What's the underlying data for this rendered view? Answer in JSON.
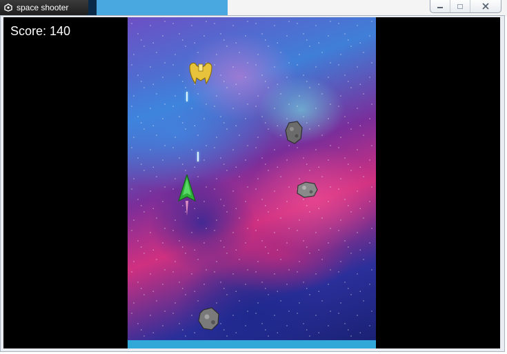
{
  "window": {
    "title": "space shooter",
    "icon": "unity-icon",
    "controls": [
      "minimize-icon",
      "maximize-icon",
      "close-icon"
    ]
  },
  "hud": {
    "score_label": "Score:",
    "score_value": "140",
    "score_text": "Score: 140"
  },
  "scene": {
    "background": "nebula-space",
    "entities": [
      {
        "type": "enemy-ship",
        "color": "#e6c33a"
      },
      {
        "type": "player-ship",
        "color": "#2fae3a"
      },
      {
        "type": "laser"
      },
      {
        "type": "laser"
      },
      {
        "type": "asteroid"
      },
      {
        "type": "asteroid"
      },
      {
        "type": "asteroid"
      }
    ]
  },
  "colors": {
    "viewport_bg": "#000000",
    "bottom_bar": "#31a8d8",
    "hud_text": "#ffffff"
  }
}
